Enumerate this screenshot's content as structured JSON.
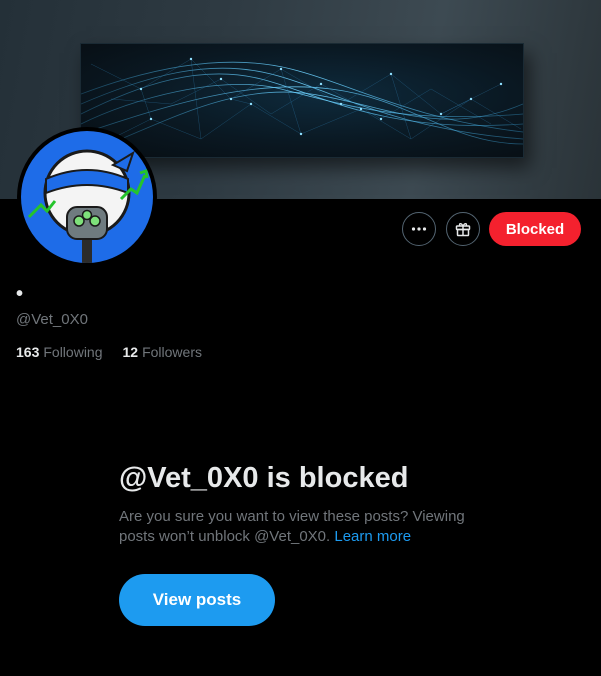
{
  "profile": {
    "display_name": "•",
    "handle": "@Vet_0X0",
    "following_count": "163",
    "following_label": "Following",
    "followers_count": "12",
    "followers_label": "Followers"
  },
  "actions": {
    "more_icon": "more-horizontal-icon",
    "gift_icon": "gift-icon",
    "blocked_label": "Blocked"
  },
  "blocked_notice": {
    "title": "@Vet_0X0 is blocked",
    "description": "Are you sure you want to view these posts? Viewing posts won’t unblock @Vet_0X0.",
    "learn_more": "Learn more",
    "view_posts_label": "View posts"
  },
  "colors": {
    "background": "#000000",
    "blocked_button": "#f4212e",
    "primary_button": "#1d9bf0",
    "link": "#1d9bf0",
    "secondary_text": "#71767b",
    "avatar_background": "#1e6ce8"
  }
}
